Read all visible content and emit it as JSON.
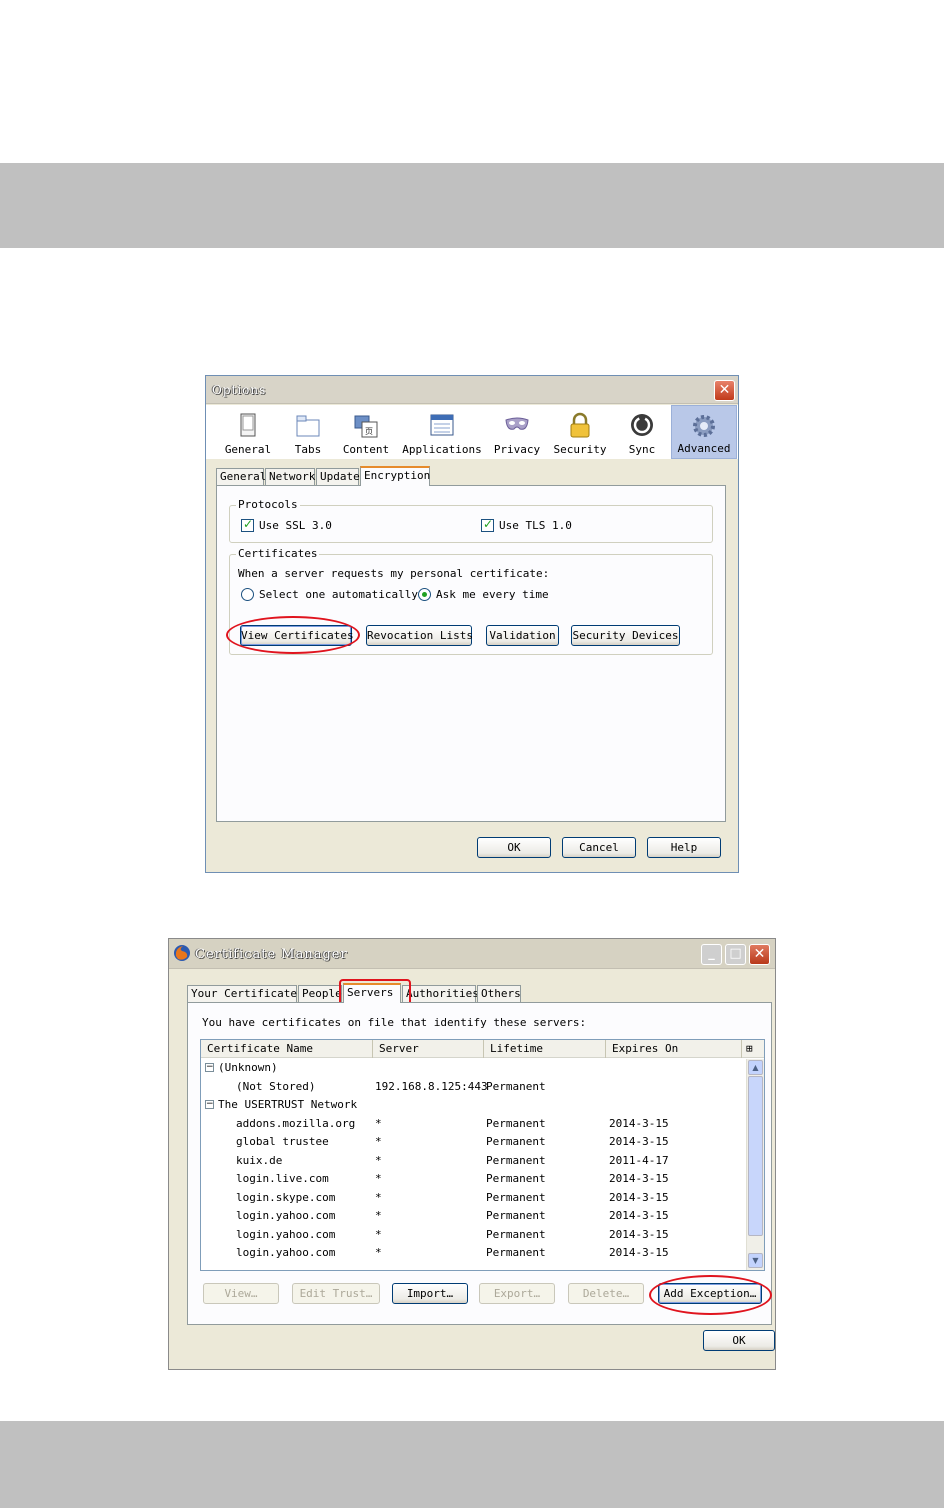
{
  "options_dialog": {
    "title": "Options",
    "close_glyph": "✕",
    "toolbar": [
      {
        "label": "General",
        "icon": "general-icon"
      },
      {
        "label": "Tabs",
        "icon": "tabs-icon"
      },
      {
        "label": "Content",
        "icon": "content-icon"
      },
      {
        "label": "Applications",
        "icon": "applications-icon"
      },
      {
        "label": "Privacy",
        "icon": "privacy-mask-icon"
      },
      {
        "label": "Security",
        "icon": "padlock-icon"
      },
      {
        "label": "Sync",
        "icon": "sync-icon"
      },
      {
        "label": "Advanced",
        "icon": "gear-icon",
        "selected": true
      }
    ],
    "tabs": [
      "General",
      "Network",
      "Update",
      "Encryption"
    ],
    "active_tab": "Encryption",
    "protocols": {
      "legend": "Protocols",
      "ssl_label": "Use SSL 3.0",
      "ssl_checked": true,
      "tls_label": "Use TLS 1.0",
      "tls_checked": true
    },
    "certificates": {
      "legend": "Certificates",
      "prompt": "When a server requests my personal certificate:",
      "radio_auto": "Select one automatically",
      "radio_ask": "Ask me every time",
      "selected_radio": "Ask me every time",
      "buttons": {
        "view": "View Certificates",
        "revocation": "Revocation Lists",
        "validation": "Validation",
        "devices": "Security Devices"
      }
    },
    "footer": {
      "ok": "OK",
      "cancel": "Cancel",
      "help": "Help"
    }
  },
  "cert_manager": {
    "title": "Certificate Manager",
    "tabs": [
      "Your Certificates",
      "People",
      "Servers",
      "Authorities",
      "Others"
    ],
    "active_tab": "Servers",
    "description": "You have certificates on file that identify these servers:",
    "columns": [
      "Certificate Name",
      "Server",
      "Lifetime",
      "Expires On"
    ],
    "rows": [
      {
        "group": true,
        "name": "(Unknown)"
      },
      {
        "name": "(Not Stored)",
        "server": "192.168.8.125:443",
        "lifetime": "Permanent",
        "expires": ""
      },
      {
        "group": true,
        "name": "The USERTRUST Network"
      },
      {
        "name": "addons.mozilla.org",
        "server": "*",
        "lifetime": "Permanent",
        "expires": "2014-3-15"
      },
      {
        "name": "global trustee",
        "server": "*",
        "lifetime": "Permanent",
        "expires": "2014-3-15"
      },
      {
        "name": "kuix.de",
        "server": "*",
        "lifetime": "Permanent",
        "expires": "2011-4-17"
      },
      {
        "name": "login.live.com",
        "server": "*",
        "lifetime": "Permanent",
        "expires": "2014-3-15"
      },
      {
        "name": "login.skype.com",
        "server": "*",
        "lifetime": "Permanent",
        "expires": "2014-3-15"
      },
      {
        "name": "login.yahoo.com",
        "server": "*",
        "lifetime": "Permanent",
        "expires": "2014-3-15"
      },
      {
        "name": "login.yahoo.com",
        "server": "*",
        "lifetime": "Permanent",
        "expires": "2014-3-15"
      },
      {
        "name": "login.yahoo.com",
        "server": "*",
        "lifetime": "Permanent",
        "expires": "2014-3-15"
      }
    ],
    "buttons": {
      "view": "View…",
      "edit_trust": "Edit Trust…",
      "import": "Import…",
      "export": "Export…",
      "delete": "Delete…",
      "add_exception": "Add Exception…"
    },
    "ok": "OK"
  },
  "colors": {
    "annotation_red": "#e0141e",
    "page_band_gray": "#c0c0c0"
  }
}
